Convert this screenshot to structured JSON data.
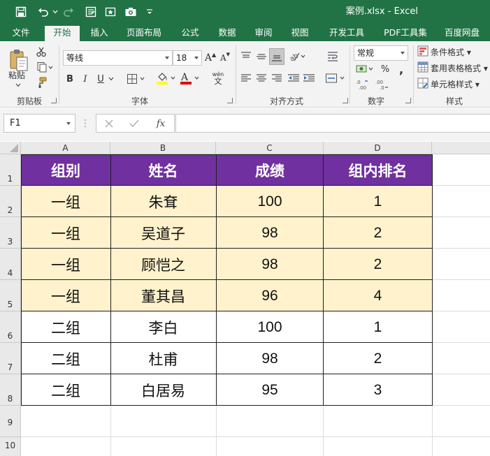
{
  "window": {
    "title": "案例.xlsx - Excel"
  },
  "colors": {
    "brand": "#217346",
    "header_fill": "#7030a0",
    "row_fill": "#fff2cc"
  },
  "quick_access": [
    "save-icon",
    "undo-icon",
    "redo-icon",
    "form-icon",
    "star-icon",
    "camera-icon",
    "customize-icon"
  ],
  "tabs": [
    "文件",
    "开始",
    "插入",
    "页面布局",
    "公式",
    "数据",
    "审阅",
    "视图",
    "开发工具",
    "PDF工具集",
    "百度网盘"
  ],
  "active_tab": "开始",
  "ribbon": {
    "clipboard": {
      "paste_label": "粘贴",
      "group_label": "剪贴板"
    },
    "font": {
      "font_name": "等线",
      "font_size": "18",
      "group_label": "字体",
      "pinyin_glyph": "wén",
      "bold": "B",
      "italic": "I",
      "underline": "U"
    },
    "alignment": {
      "group_label": "对齐方式"
    },
    "number": {
      "format": "常规",
      "group_label": "数字",
      "percent": "%"
    },
    "styles": {
      "conditional_format": "条件格式",
      "table_format": "套用表格格式",
      "cell_style": "单元格样式",
      "group_label": "样式"
    }
  },
  "formula_bar": {
    "name_box": "F1",
    "formula": ""
  },
  "sheet": {
    "columns": [
      "A",
      "B",
      "C",
      "D"
    ],
    "rows": [
      "1",
      "2",
      "3",
      "4",
      "5",
      "6",
      "7",
      "8",
      "9",
      "10"
    ],
    "header": [
      "组别",
      "姓名",
      "成绩",
      "组内排名"
    ],
    "data": [
      [
        "一组",
        "朱耷",
        "100",
        "1"
      ],
      [
        "一组",
        "吴道子",
        "98",
        "2"
      ],
      [
        "一组",
        "顾恺之",
        "98",
        "2"
      ],
      [
        "一组",
        "董其昌",
        "96",
        "4"
      ],
      [
        "二组",
        "李白",
        "100",
        "1"
      ],
      [
        "二组",
        "杜甫",
        "98",
        "2"
      ],
      [
        "二组",
        "白居易",
        "95",
        "3"
      ]
    ]
  }
}
